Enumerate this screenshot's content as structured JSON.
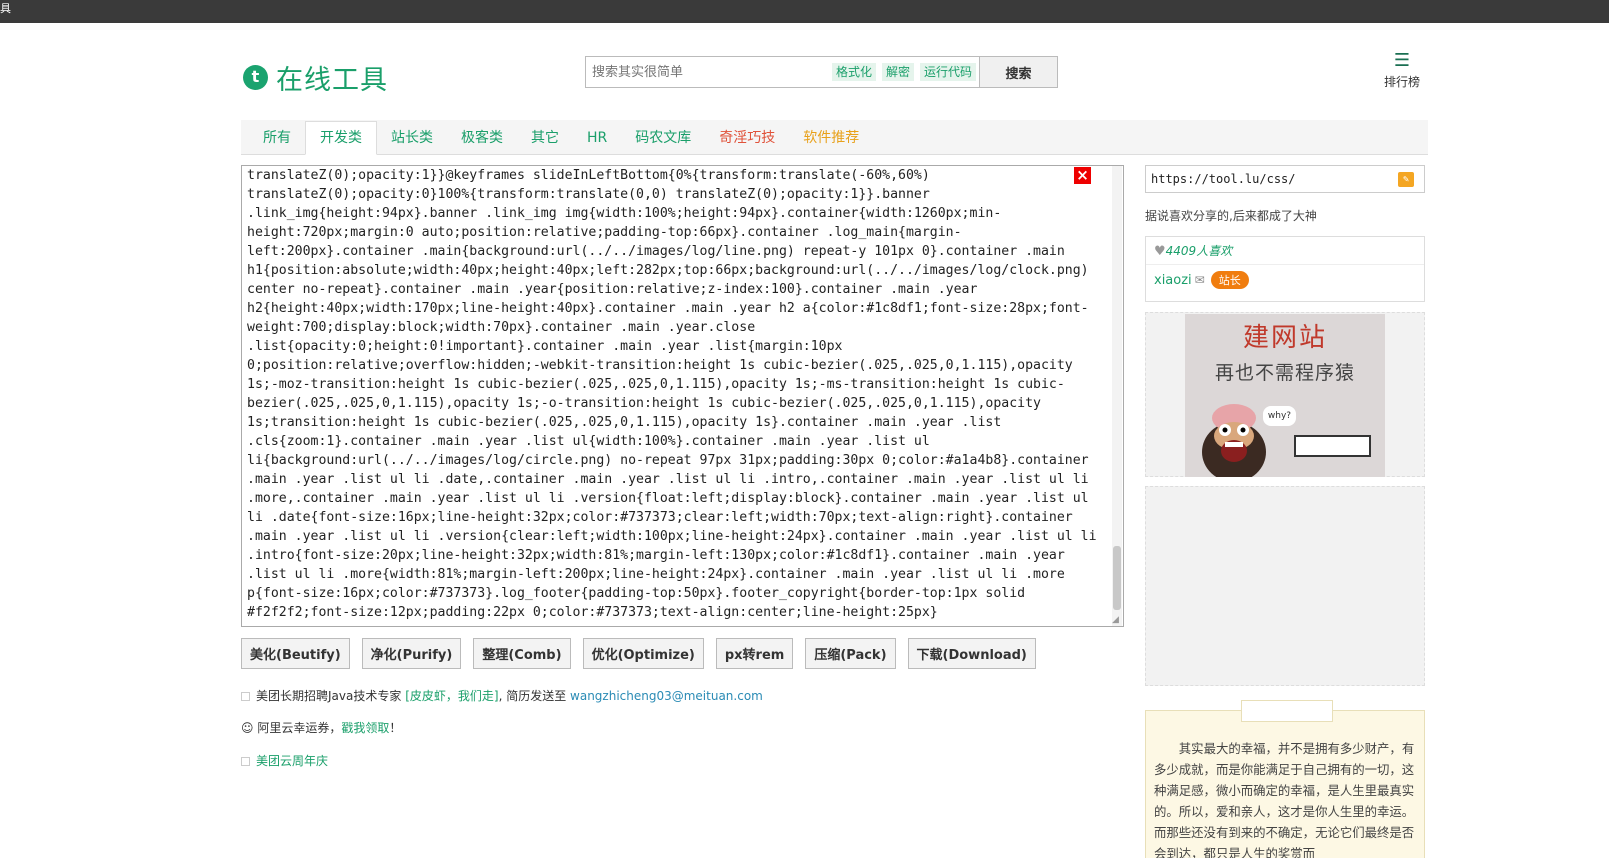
{
  "topbar": {
    "text": "具"
  },
  "logo": {
    "icon": "t",
    "title": "在线工具"
  },
  "search": {
    "placeholder": "搜索其实很简单",
    "quick_links": [
      "格式化",
      "解密",
      "运行代码"
    ],
    "button": "搜索"
  },
  "rank": {
    "icon": "list-icon",
    "label": "排行榜"
  },
  "tabs": [
    {
      "label": "所有",
      "color": "#1a9f6a"
    },
    {
      "label": "开发类",
      "color": "#1a9f6a"
    },
    {
      "label": "站长类",
      "color": "#1a9f6a"
    },
    {
      "label": "极客类",
      "color": "#1a9f6a"
    },
    {
      "label": "其它",
      "color": "#1a9f6a"
    },
    {
      "label": "HR",
      "color": "#1a9f6a"
    },
    {
      "label": "码农文库",
      "color": "#1a9f6a"
    },
    {
      "label": "奇淫巧技",
      "color": "#e0523a"
    },
    {
      "label": "软件推荐",
      "color": "#e8a11b"
    }
  ],
  "active_tab": "开发类",
  "editor": {
    "content": "translateZ(0);opacity:1}}@keyframes slideInLeftBottom{0%{transform:translate(-60%,60%)\ntranslateZ(0);opacity:0}100%{transform:translate(0,0) translateZ(0);opacity:1}}.banner\n.link_img{height:94px}.banner .link_img img{width:100%;height:94px}.container{width:1260px;min-\nheight:720px;margin:0 auto;position:relative;padding-top:66px}.container .log_main{margin-\nleft:200px}.container .main{background:url(../../images/log/line.png) repeat-y 101px 0}.container .main\nh1{position:absolute;width:40px;height:40px;left:282px;top:66px;background:url(../../images/log/clock.png)\ncenter no-repeat}.container .main .year{position:relative;z-index:100}.container .main .year\nh2{height:40px;width:170px;line-height:40px}.container .main .year h2 a{color:#1c8df1;font-size:28px;font-\nweight:700;display:block;width:70px}.container .main .year.close\n.list{opacity:0;height:0!important}.container .main .year .list{margin:10px\n0;position:relative;overflow:hidden;-webkit-transition:height 1s cubic-bezier(.025,.025,0,1.115),opacity\n1s;-moz-transition:height 1s cubic-bezier(.025,.025,0,1.115),opacity 1s;-ms-transition:height 1s cubic-\nbezier(.025,.025,0,1.115),opacity 1s;-o-transition:height 1s cubic-bezier(.025,.025,0,1.115),opacity\n1s;transition:height 1s cubic-bezier(.025,.025,0,1.115),opacity 1s}.container .main .year .list\n.cls{zoom:1}.container .main .year .list ul{width:100%}.container .main .year .list ul\nli{background:url(../../images/log/circle.png) no-repeat 97px 31px;padding:30px 0;color:#a1a4b8}.container\n.main .year .list ul li .date,.container .main .year .list ul li .intro,.container .main .year .list ul li\n.more,.container .main .year .list ul li .version{float:left;display:block}.container .main .year .list ul\nli .date{font-size:16px;line-height:32px;color:#737373;clear:left;width:70px;text-align:right}.container\n.main .year .list ul li .version{clear:left;width:100px;line-height:24px}.container .main .year .list ul li\n.intro{font-size:20px;line-height:32px;width:81%;margin-left:130px;color:#1c8df1}.container .main .year\n.list ul li .more{width:81%;margin-left:200px;line-height:24px}.container .main .year .list ul li .more\np{font-size:16px;color:#737373}.log_footer{padding-top:50px}.footer_copyright{border-top:1px solid\n#f2f2f2;font-size:12px;padding:22px 0;color:#737373;text-align:center;line-height:25px}",
    "close_icon": "close-icon"
  },
  "actions": [
    "美化(Beutify)",
    "净化(Purify)",
    "整理(Comb)",
    "优化(Optimize)",
    "px转rem",
    "压缩(Pack)",
    "下载(Download)"
  ],
  "notes": {
    "job_prefix": "美团长期招聘Java技术专家",
    "job_link": "[皮皮虾，我们走]",
    "job_mid": ", 简历发送至",
    "job_email": "wangzhicheng03@meituan.com",
    "aliyun_prefix": "阿里云幸运券，",
    "aliyun_link": "戳我领取",
    "aliyun_suffix": "！",
    "meituan_cloud": "美团云周年庆"
  },
  "sidebar": {
    "url": "https://tool.lu/css/",
    "slogan": "据说喜欢分享的,后来都成了大神",
    "likes": "4409人喜欢",
    "author": "xiaozi",
    "badge": "站长",
    "ad_title": "建网站",
    "ad_subtitle": "再也不需程序猿",
    "ad_bubble": "why?",
    "quote": "其实最大的幸福，并不是拥有多少财产，有多少成就，而是你能满足于自己拥有的一切，这种满足感，微小而确定的幸福，是人生里最真实的。所以，爱和亲人，这才是你人生里的幸运。而那些还没有到来的不确定，无论它们最终是否会到达，都只是人生的奖赏而"
  },
  "colors": {
    "brand_green": "#1a9f6a",
    "close_red": "#e00000",
    "badge_orange": "#f07d0f"
  }
}
